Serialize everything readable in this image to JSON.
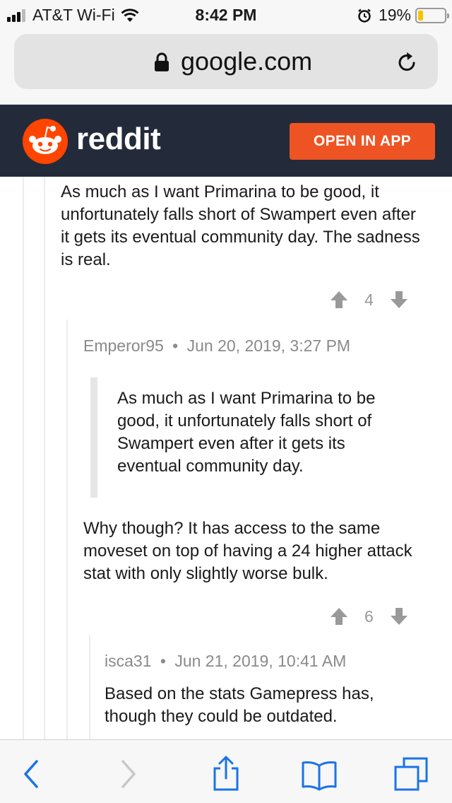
{
  "status_bar": {
    "carrier": "AT&T Wi-Fi",
    "time": "8:42 PM",
    "battery": "19%",
    "battery_level": 0.19
  },
  "browser": {
    "url": "google.com"
  },
  "header": {
    "wordmark": "reddit",
    "open_app_label": "OPEN IN APP",
    "accent_color": "#ee5423",
    "bg_color": "#232b3a"
  },
  "comments": [
    {
      "body": "As much as I want Primarina to be good, it unfortunately falls short of Swampert even after it gets its eventual community day. The sadness is real.",
      "votes": "4"
    },
    {
      "author": "Emperor95",
      "date": "Jun 20, 2019, 3:27 PM",
      "quote": "As much as I want Primarina to be good, it unfortunately falls short of Swampert even after it gets its eventual community day.",
      "body": "Why though? It has access to the same moveset on top of having a 24 higher attack stat with only slightly worse bulk.",
      "votes": "6"
    },
    {
      "author": "isca31",
      "date": "Jun 21, 2019, 10:41 AM",
      "body": "Based on the stats Gamepress has, though they could be outdated."
    }
  ],
  "separator": "•",
  "toolbar": {
    "icons": [
      "back-icon",
      "forward-icon",
      "share-icon",
      "bookmarks-icon",
      "tabs-icon"
    ]
  }
}
